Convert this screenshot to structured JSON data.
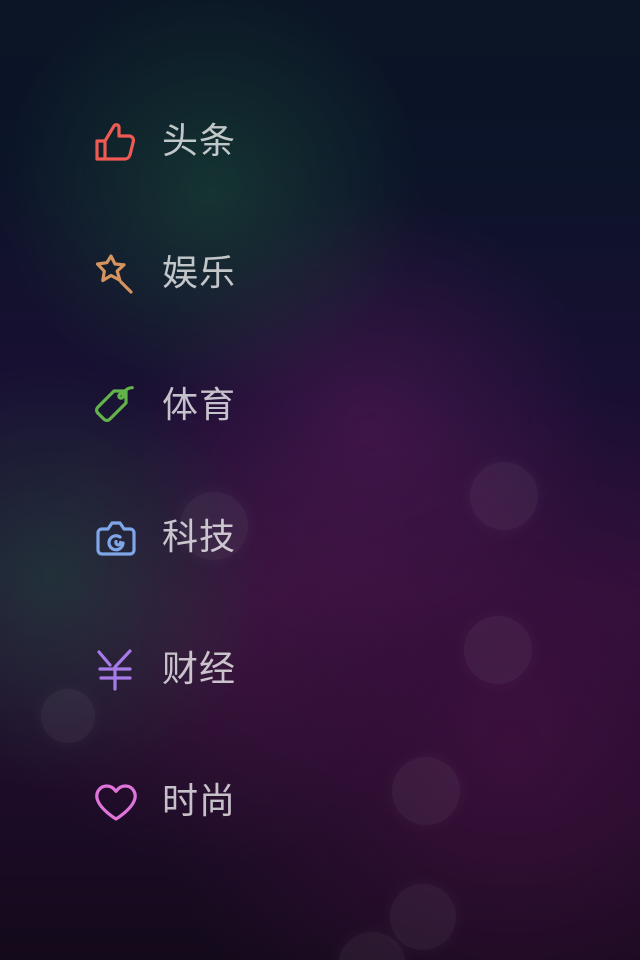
{
  "menu": {
    "items": [
      {
        "label": "头条",
        "icon": "thumbs-up-icon",
        "color": "#ef5a52"
      },
      {
        "label": "娱乐",
        "icon": "star-wand-icon",
        "color": "#d4935f"
      },
      {
        "label": "体育",
        "icon": "tag-icon",
        "color": "#63b44a"
      },
      {
        "label": "科技",
        "icon": "camera-icon",
        "color": "#7fa6e8"
      },
      {
        "label": "财经",
        "icon": "yen-icon",
        "color": "#a67be8"
      },
      {
        "label": "时尚",
        "icon": "heart-icon",
        "color": "#df74d9"
      }
    ]
  },
  "theme": {
    "text_color": "#c9c9cf"
  }
}
